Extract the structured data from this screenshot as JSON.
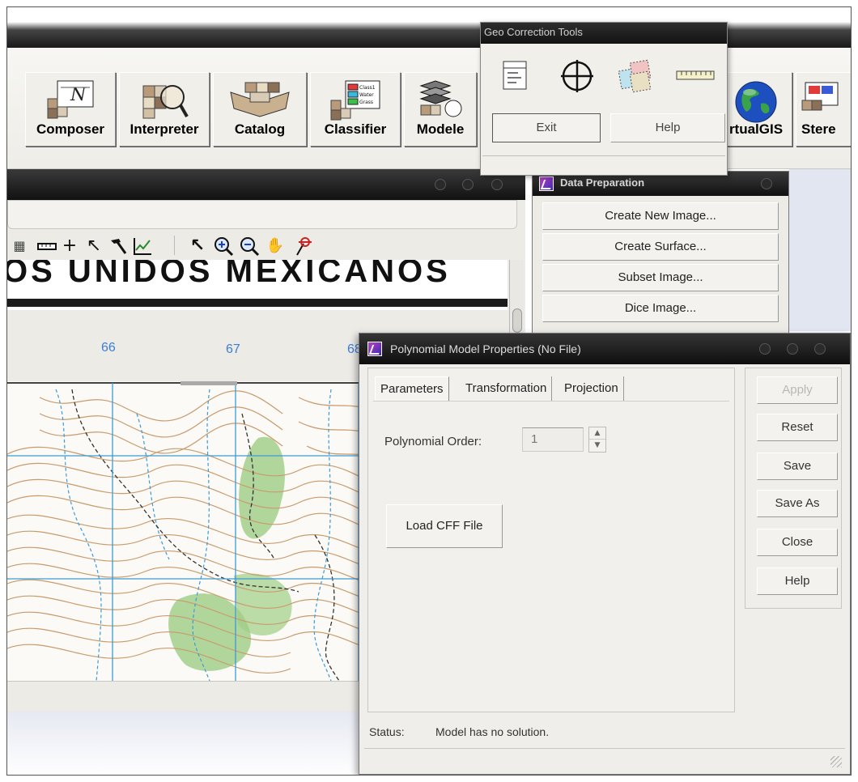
{
  "toolbar": {
    "buttons": [
      {
        "label": "Composer",
        "icon": "composer-icon"
      },
      {
        "label": "Interpreter",
        "icon": "interpreter-icon"
      },
      {
        "label": "Catalog",
        "icon": "catalog-icon"
      },
      {
        "label": "Classifier",
        "icon": "classifier-icon"
      },
      {
        "label": "Modele",
        "icon": "modeler-icon"
      },
      {
        "label": "rtualGIS",
        "icon": "globe-icon"
      },
      {
        "label": "Stere",
        "icon": "stereo-icon"
      }
    ],
    "classifier_legend": [
      "Class1",
      "Water",
      "Grass"
    ]
  },
  "viewer": {
    "map_header_text": "OS UNIDOS MEXICANOS",
    "grid_labels": [
      "66",
      "67",
      "68"
    ],
    "tools": [
      "measure-icon",
      "crosshair-icon",
      "select-arrow-icon",
      "hammer-icon",
      "profile-icon",
      "pointer-icon",
      "zoom-in-icon",
      "zoom-out-icon",
      "pan-hand-icon",
      "pin-icon"
    ]
  },
  "data_prep": {
    "title": "Data Preparation",
    "items": [
      "Create New Image...",
      "Create Surface...",
      "Subset Image...",
      "Dice Image..."
    ]
  },
  "geo_tools": {
    "title": "Geo Correction Tools",
    "icons": [
      "properties-icon",
      "gcp-crosshair-icon",
      "overlap-icon",
      "ruler-icon"
    ],
    "exit_label": "Exit",
    "help_label": "Help"
  },
  "poly": {
    "title": "Polynomial Model Properties (No File)",
    "tabs": [
      "Parameters",
      "Transformation",
      "Projection"
    ],
    "order_label": "Polynomial Order:",
    "order_value": "1",
    "load_label": "Load CFF File",
    "buttons": [
      {
        "label": "Apply",
        "enabled": false
      },
      {
        "label": "Reset",
        "enabled": true
      },
      {
        "label": "Save",
        "enabled": true
      },
      {
        "label": "Save As",
        "enabled": true
      },
      {
        "label": "Close",
        "enabled": true
      },
      {
        "label": "Help",
        "enabled": true
      }
    ],
    "status_label": "Status:",
    "status_text": "Model has no solution."
  },
  "colors": {
    "title_bar": "#1a1a1a",
    "contour": "#c99a6c",
    "water": "#3c9ad8",
    "vegetation": "#8fc27a",
    "grid_label": "#3c7dd8"
  }
}
